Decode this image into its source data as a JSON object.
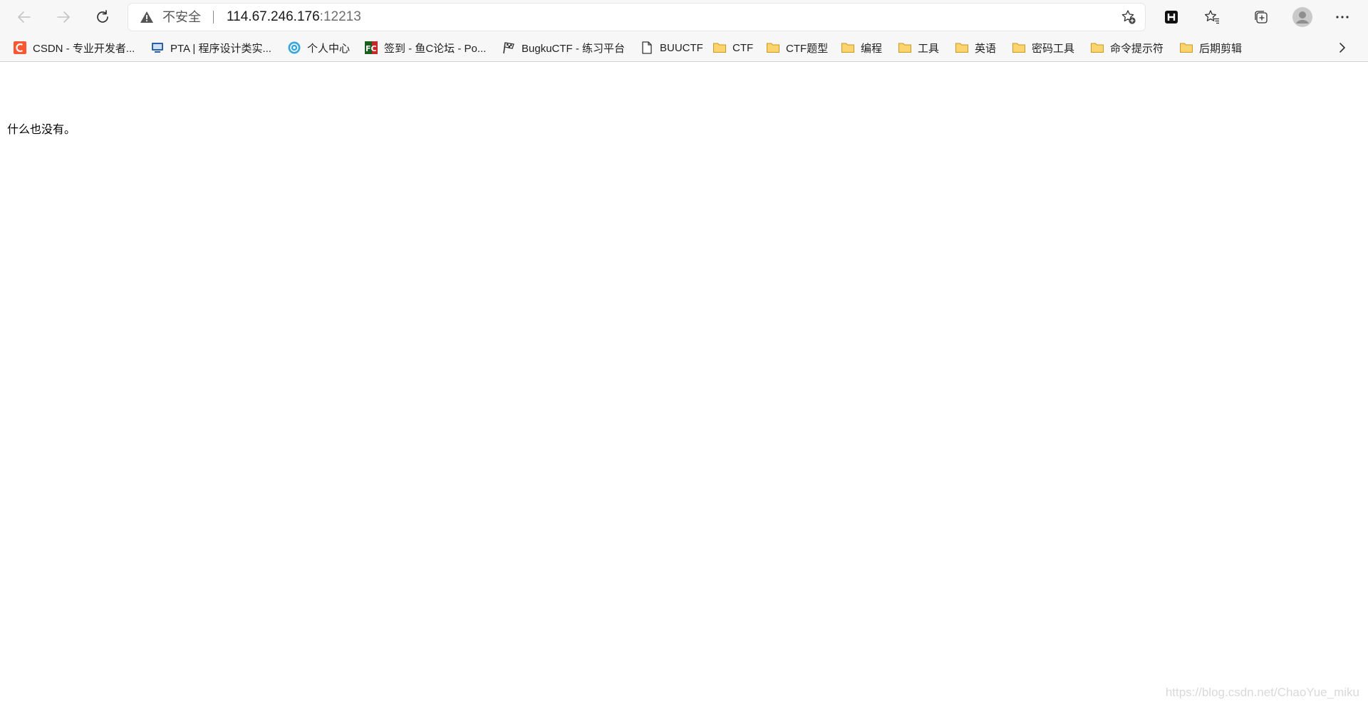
{
  "toolbar": {
    "back_icon": "arrow-left-icon",
    "forward_icon": "arrow-right-icon",
    "refresh_icon": "refresh-icon",
    "address": {
      "security_label": "不安全",
      "host": "114.67.246.176",
      "port": ":12213",
      "warning_icon": "warning-triangle-icon",
      "favorite_icon": "star-add-icon"
    },
    "right_icons": [
      "extension-h-icon",
      "favorites-star-icon",
      "collections-icon",
      "profile-avatar-icon",
      "more-dots-icon"
    ]
  },
  "bookmarks": [
    {
      "label": "CSDN - 专业开发者...",
      "icon": "csdn-icon",
      "color": "#fc5531"
    },
    {
      "label": "PTA | 程序设计类实...",
      "icon": "pta-icon",
      "color": "#2b5fa8"
    },
    {
      "label": "个人中心",
      "icon": "personal-center-icon",
      "color": "#3aa6e0"
    },
    {
      "label": "签到 - 鱼C论坛 - Po...",
      "icon": "fishc-icon",
      "color": "#1b5e20"
    },
    {
      "label": "BugkuCTF - 练习平台",
      "icon": "flag-icon",
      "color": "#444444"
    },
    {
      "label": "BUUCTF",
      "icon": "page-icon",
      "color": "#444444"
    },
    {
      "label": "CTF",
      "icon": "folder-icon",
      "color": "#f4c542"
    },
    {
      "label": "CTF题型",
      "icon": "folder-icon",
      "color": "#f4c542"
    },
    {
      "label": "编程",
      "icon": "folder-icon",
      "color": "#f4c542"
    },
    {
      "label": "工具",
      "icon": "folder-icon",
      "color": "#f4c542"
    },
    {
      "label": "英语",
      "icon": "folder-icon",
      "color": "#f4c542"
    },
    {
      "label": "密码工具",
      "icon": "folder-icon",
      "color": "#f4c542"
    },
    {
      "label": "命令提示符",
      "icon": "folder-icon",
      "color": "#f4c542"
    },
    {
      "label": "后期剪辑",
      "icon": "folder-icon",
      "color": "#f4c542"
    }
  ],
  "bookmarks_more_icon": "chevron-right-icon",
  "page": {
    "text": "什么也没有。"
  },
  "watermark": "https://blog.csdn.net/ChaoYue_miku"
}
